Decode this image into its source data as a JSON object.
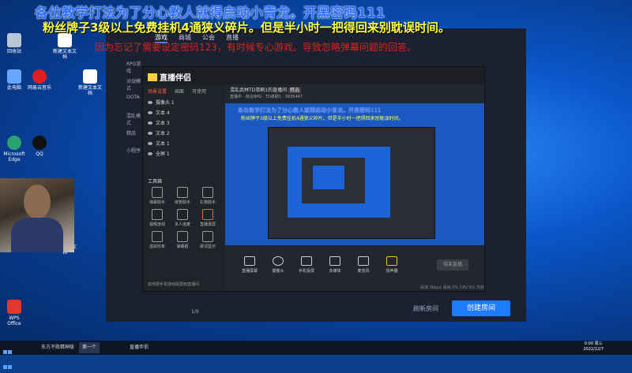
{
  "overlay": {
    "line1": "各位教学打法为了分心教人就得启动小青龙。开黑密码111",
    "line2": "粉丝牌子3级以上免费挂机4通狭义碎片。但是半小时一把得回来别耽误时间。",
    "line3": "因为忘记了需要设定密码123，有时候专心游戏。导致忽略弹幕问题的回答。"
  },
  "desktop_icons": [
    {
      "label": "回收站",
      "color": "#b9c6d6"
    },
    {
      "label": "此电脑",
      "color": "#66a6ff"
    },
    {
      "label": "Microsoft Edge",
      "color": "#2aa36e"
    },
    {
      "label": "QQ",
      "color": "#111111"
    },
    {
      "label": "网易云音乐",
      "color": "#e02020"
    },
    {
      "label": "WPS Office",
      "color": "#e0382c"
    },
    {
      "label": "新建文本文档",
      "color": "#ffffff"
    }
  ],
  "bg_app": {
    "tabs": [
      "游戏",
      "商城",
      "公会",
      "直播"
    ],
    "active_tab": "游戏",
    "sidebar": [
      "RPG游戏",
      "对战模式",
      "DOTA",
      "混乱模式",
      "精品",
      "小程序"
    ],
    "pager": "1/9",
    "refresh_label": "刷新房间",
    "create_label": "创建房间"
  },
  "obs": {
    "app_name": "直播伴侣",
    "left_tabs": [
      "场景设置",
      "画面",
      "可使用"
    ],
    "active_left_tab": "场景设置",
    "sources": [
      "摄像头 1",
      "文本 4",
      "文本 3",
      "文本 2",
      "文本 1",
      "全屏 1"
    ],
    "tools_title": "工具箱",
    "tools": [
      "弹幕助手",
      "房管助手",
      "礼物助手",
      "视频连线",
      "多人连麦",
      "直播录屏",
      "虚拟形象",
      "弹幕姬",
      "歌词显示"
    ],
    "hint": "如何把手机游戏投屏到直播间",
    "room_title": "混乱武林TD单刷1的直播间",
    "room_tag": "精选",
    "room_sub": "直播中  · 综合RPG  · TD单刷1  · 3935447",
    "preview_line1": "各位教学打法为了分心教人就得启动小青龙。开黑密码111",
    "preview_line2": "粉丝牌子3级以上免费挂机4通狭义碎片。但是半小时一把得回来别耽误时间。",
    "controls": [
      "直播屏幕",
      "摄像头",
      "手机投屏",
      "多媒体",
      "麦克风",
      "扬声器"
    ],
    "start_label": "结束直播",
    "status": "码率 0kbps  丢帧 0%  CPU 0%  内存"
  },
  "taskbar": {
    "items": [
      "东方不败精神版",
      "第一个",
      "直播伴侣"
    ],
    "time": "0:00 周三",
    "date": "2022/12/7"
  }
}
